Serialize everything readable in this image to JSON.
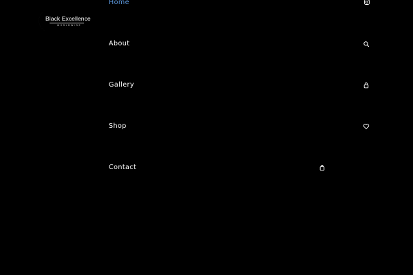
{
  "brand": {
    "name": "Black Excellence",
    "tagline": "WORLDWIDE"
  },
  "nav": {
    "items": [
      {
        "label": "Home",
        "active": true
      },
      {
        "label": "About",
        "active": false
      },
      {
        "label": "Gallery",
        "active": false
      },
      {
        "label": "Shop",
        "active": false
      },
      {
        "label": "Contact",
        "active": false
      }
    ]
  },
  "icons": [
    "instagram-icon",
    "search-icon",
    "lock-icon",
    "heart-icon",
    "shopping-bag-icon"
  ],
  "colors": {
    "background": "#000000",
    "text": "#ffffff",
    "accent": "#5d9ae0"
  }
}
